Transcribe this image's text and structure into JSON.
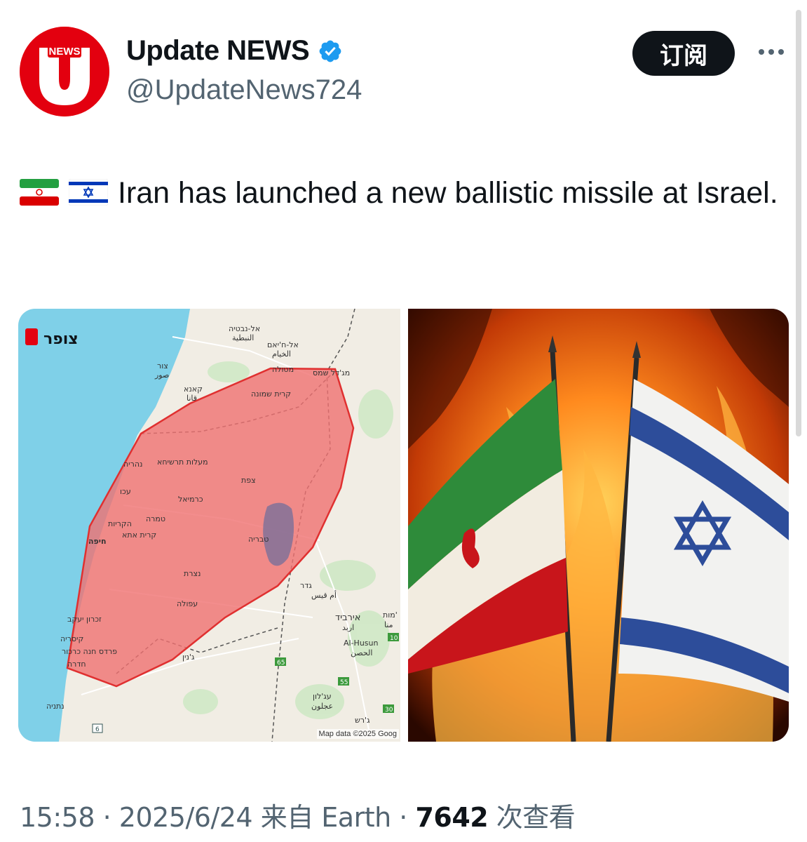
{
  "author": {
    "display_name": "Update NEWS",
    "handle": "@UpdateNews724",
    "avatar_text": "NEWS",
    "avatar_letter": "U",
    "verified_icon": "verified-badge-icon"
  },
  "actions": {
    "subscribe_label": "订阅",
    "more_icon": "more-horizontal-icon"
  },
  "tweet": {
    "flags": [
      "iran-flag",
      "israel-flag"
    ],
    "text": "Iran has launched a new ballistic missile at Israel."
  },
  "map": {
    "alert_label": "צופר",
    "attribution": "Map data ©2025 Goog",
    "labels": [
      {
        "text": "אל-נבטיה"
      },
      {
        "text": "النبطية"
      },
      {
        "text": "אל-ח'יאם"
      },
      {
        "text": "الخيام"
      },
      {
        "text": "צור"
      },
      {
        "text": "صور"
      },
      {
        "text": "קאנא"
      },
      {
        "text": "قانا"
      },
      {
        "text": "מטולה"
      },
      {
        "text": "מג'דל שמס"
      },
      {
        "text": "קרית שמונה"
      },
      {
        "text": "נהריה"
      },
      {
        "text": "מעלות תרשיחא"
      },
      {
        "text": "צפת"
      },
      {
        "text": "עכו"
      },
      {
        "text": "כרמיאל"
      },
      {
        "text": "הקריות"
      },
      {
        "text": "טמרה"
      },
      {
        "text": "קרית אתא"
      },
      {
        "text": "חיפה"
      },
      {
        "text": "טבריה"
      },
      {
        "text": "נצרת"
      },
      {
        "text": "גדר"
      },
      {
        "text": "أم قيس"
      },
      {
        "text": "עפולה"
      },
      {
        "text": "זכרון יעקב"
      },
      {
        "text": "אירביד"
      },
      {
        "text": "اربد"
      },
      {
        "text": "Al-Husun"
      },
      {
        "text": "الحصن"
      },
      {
        "text": "קיסריה"
      },
      {
        "text": "פרדס חנה כרכור"
      },
      {
        "text": "ג'נין"
      },
      {
        "text": "חדרה"
      },
      {
        "text": "עג'לון"
      },
      {
        "text": "عجلون"
      },
      {
        "text": "נתניה"
      },
      {
        "text": "ג'רש"
      },
      {
        "text": "מות'"
      },
      {
        "text": "منا"
      }
    ],
    "road_shields": [
      "65",
      "55",
      "10",
      "30",
      "6"
    ]
  },
  "footer": {
    "time": "15:58",
    "sep1": " · ",
    "date": "2025/6/24",
    "source_prefix": " 来自 ",
    "source": "Earth",
    "sep2": " · ",
    "views": "7642",
    "views_suffix": " 次查看"
  },
  "colors": {
    "alert_red": "#e3000f",
    "verified_blue": "#1d9bf0",
    "text_primary": "#0f1419",
    "text_secondary": "#536471",
    "map_water": "#7fd0e8",
    "alert_polygon": "#f07070"
  }
}
